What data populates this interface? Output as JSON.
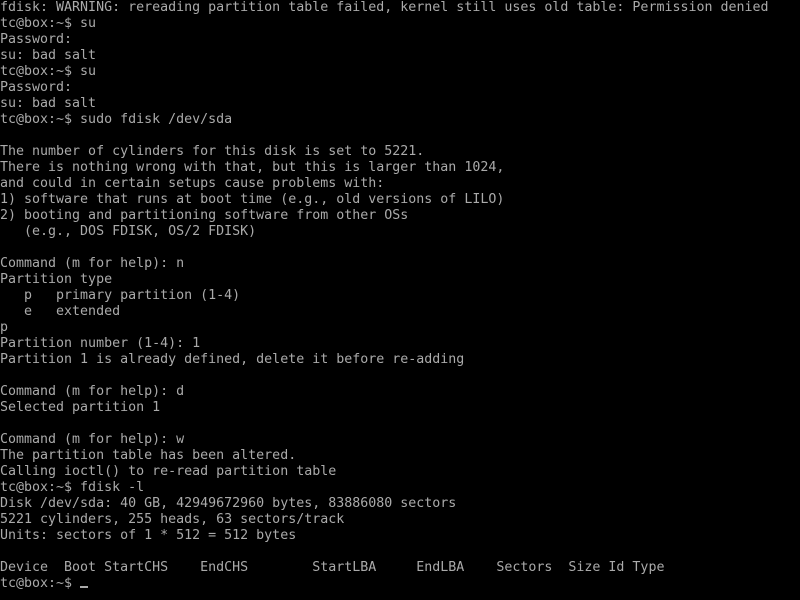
{
  "terminal": {
    "colors": {
      "background": "#000000",
      "foreground": "#aaaaaa"
    },
    "lines": [
      "fdisk: WARNING: rereading partition table failed, kernel still uses old table: Permission denied",
      "tc@box:~$ su",
      "Password:",
      "su: bad salt",
      "tc@box:~$ su",
      "Password:",
      "su: bad salt",
      "tc@box:~$ sudo fdisk /dev/sda",
      "",
      "The number of cylinders for this disk is set to 5221.",
      "There is nothing wrong with that, but this is larger than 1024,",
      "and could in certain setups cause problems with:",
      "1) software that runs at boot time (e.g., old versions of LILO)",
      "2) booting and partitioning software from other OSs",
      "   (e.g., DOS FDISK, OS/2 FDISK)",
      "",
      "Command (m for help): n",
      "Partition type",
      "   p   primary partition (1-4)",
      "   e   extended",
      "p",
      "Partition number (1-4): 1",
      "Partition 1 is already defined, delete it before re-adding",
      "",
      "Command (m for help): d",
      "Selected partition 1",
      "",
      "Command (m for help): w",
      "The partition table has been altered.",
      "Calling ioctl() to re-read partition table",
      "tc@box:~$ fdisk -l",
      "Disk /dev/sda: 40 GB, 42949672960 bytes, 83886080 sectors",
      "5221 cylinders, 255 heads, 63 sectors/track",
      "Units: sectors of 1 * 512 = 512 bytes",
      "",
      "Device  Boot StartCHS    EndCHS        StartLBA     EndLBA    Sectors  Size Id Type"
    ],
    "prompt": "tc@box:~$ "
  }
}
